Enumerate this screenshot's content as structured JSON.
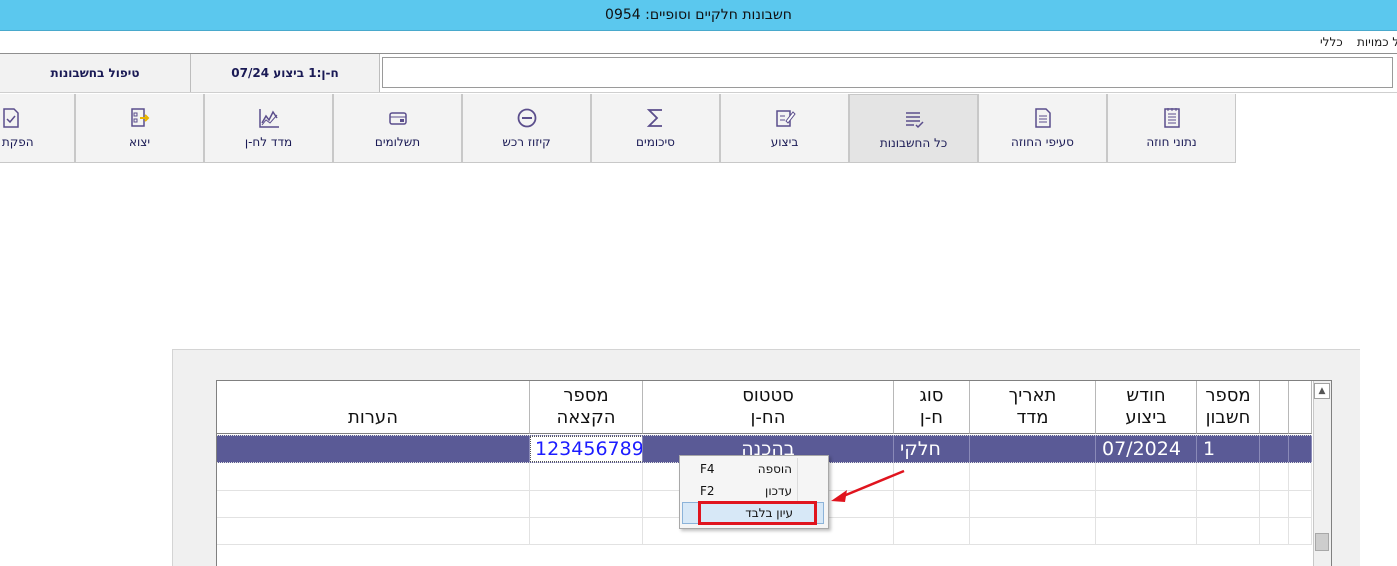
{
  "window": {
    "title": "0954 :חשבונות חלקיים וסופיים"
  },
  "menu": {
    "items": [
      "כללי",
      "ניהול כמויות"
    ]
  },
  "info": {
    "right_label": "טיפול בחשבונות",
    "center_label": "ח-ן:1 ביצוע 07/24",
    "input_value": ""
  },
  "tabs": [
    {
      "label": "נתוני חוזה",
      "icon": "document-list-icon"
    },
    {
      "label": "סעיפי החוזה",
      "icon": "document-lines-icon"
    },
    {
      "label": "כל החשבונות",
      "icon": "lines-check-icon"
    },
    {
      "label": "ביצוע",
      "icon": "edit-pencil-icon"
    },
    {
      "label": "סיכומים",
      "icon": "sigma-icon"
    },
    {
      "label": "קיזוז רכש",
      "icon": "minus-circle-icon"
    },
    {
      "label": "תשלומים",
      "icon": "wallet-icon"
    },
    {
      "label": "מדד לח-ן",
      "icon": "line-chart-icon"
    },
    {
      "label": "יצוא",
      "icon": "export-icon"
    },
    {
      "label": "הפקת אי",
      "icon": "check-document-icon"
    }
  ],
  "grid": {
    "columns": [
      {
        "line1": "מספר",
        "line2": "חשבון"
      },
      {
        "line1": "חודש",
        "line2": "ביצוע"
      },
      {
        "line1": "תאריך",
        "line2": "מדד"
      },
      {
        "line1": "סוג",
        "line2": "ח-ן"
      },
      {
        "line1": "סטטוס",
        "line2": "הח-ן"
      },
      {
        "line1": "מספר",
        "line2": "הקצאה"
      },
      {
        "line1": "",
        "line2": "הערות"
      }
    ],
    "rows": [
      {
        "account_no": "1",
        "month": "07/2024",
        "index_date": "",
        "type": "חלקי",
        "status": "בהכנה",
        "budget_no": "123456789",
        "notes": ""
      }
    ]
  },
  "context_menu": {
    "items": [
      {
        "label": "הוספה",
        "shortcut": "F4"
      },
      {
        "label": "עדכון",
        "shortcut": "F2"
      },
      {
        "label": "עיון בלבד",
        "shortcut": ""
      }
    ]
  },
  "colors": {
    "titlebar": "#5bc8ee",
    "selected_row": "#5a5a96",
    "highlight": "#e0141e",
    "link_text": "#1c1cff"
  }
}
